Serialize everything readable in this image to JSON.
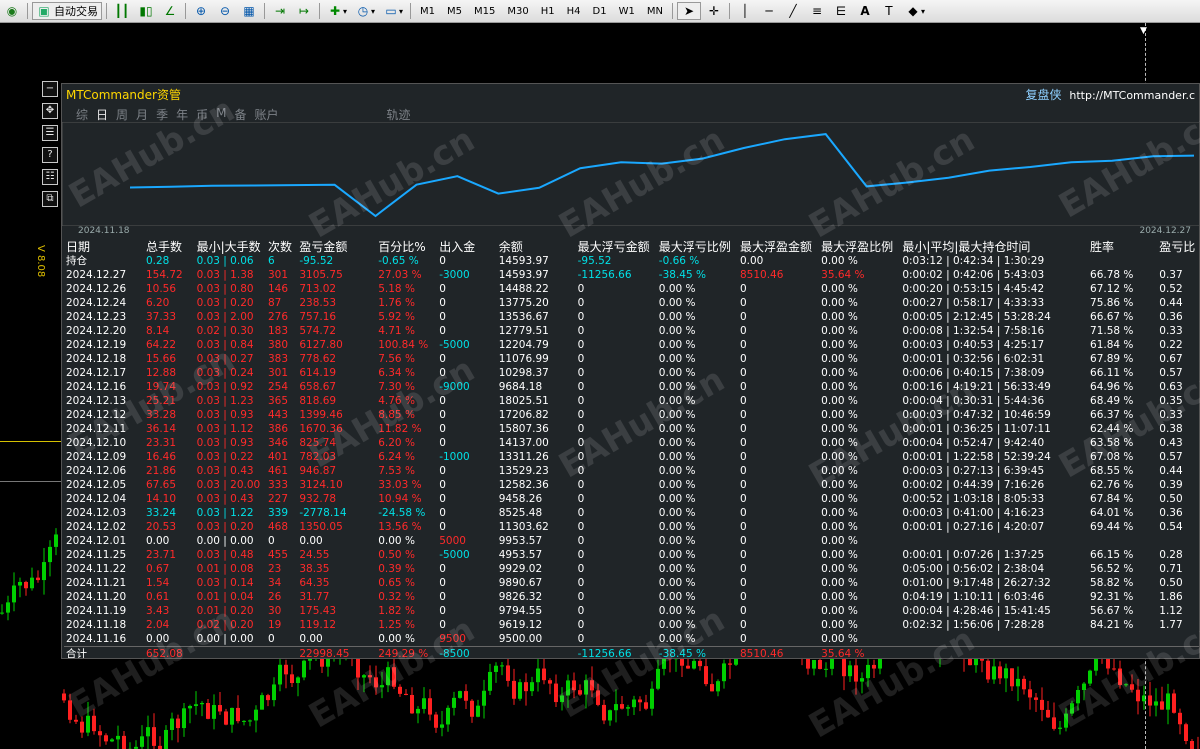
{
  "toolbar": {
    "autotrade_label": "自动交易",
    "timeframes": [
      "M1",
      "M5",
      "M15",
      "M30",
      "H1",
      "H4",
      "D1",
      "W1",
      "MN"
    ],
    "icons": [
      "globe-icon",
      "autotrade-icon",
      "bar-chart-icon",
      "candlestick-icon",
      "line-chart-icon",
      "zoom-in-icon",
      "zoom-out-icon",
      "tile-windows-icon",
      "chart-shift-icon",
      "autoscroll-icon",
      "new-order-icon",
      "clock-icon",
      "template-icon",
      "cursor-icon",
      "crosshair-icon",
      "vertical-line-icon",
      "horizontal-line-icon",
      "trendline-icon",
      "fibonacci-icon",
      "channel-icon",
      "text-icon",
      "text-label-icon",
      "shapes-icon"
    ]
  },
  "side_tools": [
    "−",
    "✥",
    "☰",
    "?",
    "☷",
    "⧉"
  ],
  "vertical_label": "V 8.08",
  "panel": {
    "title": "MTCommander资管",
    "brand": "复盘侠",
    "url": "http://MTCommander.c",
    "tabs": [
      "综",
      "日",
      "周",
      "月",
      "季",
      "年",
      "币",
      "M",
      "备",
      "账户",
      "轨迹"
    ],
    "active_tab": "日",
    "date_start": "2024.11.18",
    "date_end": "2024.12.27",
    "equity_curve": [
      9500,
      9619.12,
      9794.55,
      9826.32,
      9890.67,
      9929.02,
      4953.57,
      9953.57,
      11303.62,
      8525.48,
      9458.26,
      12582.36,
      13529.23,
      13311.26,
      14137,
      15807.36,
      17206.82,
      18025.51,
      9684.18,
      10298.37,
      11076.99,
      12204.79,
      12779.51,
      13536.67,
      13775.2,
      14488.22,
      14593.97
    ],
    "headers": [
      "日期",
      "总手数",
      "最小|大手数",
      "次数",
      "盈亏金额",
      "百分比%",
      "出入金",
      "余额",
      "最大浮亏金额",
      "最大浮亏比例",
      "最大浮盈金额",
      "最大浮盈比例",
      "最小|平均|最大持仓时间",
      "胜率",
      "盈亏比"
    ],
    "holding": {
      "label": "持仓",
      "lots": "0.28",
      "minmax": "0.03 | 0.06",
      "count": "6",
      "pnl": "-95.52",
      "pct": "-0.65 %",
      "io": "0",
      "balance": "14593.97",
      "maxloss": "-95.52",
      "maxlosspct": "-0.66 %",
      "maxprofit": "0.00",
      "maxprofitpct": "0.00 %",
      "time": "0:03:12 | 0:42:34 | 1:30:29",
      "win": "",
      "ratio": ""
    },
    "rows": [
      [
        "2024.12.27",
        "154.72",
        "0.03 | 1.38",
        "301",
        "3105.75",
        "27.03 %",
        "-3000",
        "14593.97",
        "-11256.66",
        "-38.45 %",
        "8510.46",
        "35.64 %",
        "0:00:02 | 0:42:06 | 5:43:03",
        "66.78 %",
        "0.37"
      ],
      [
        "2024.12.26",
        "10.56",
        "0.03 | 0.80",
        "146",
        "713.02",
        "5.18 %",
        "0",
        "14488.22",
        "0",
        "0.00 %",
        "0",
        "0.00 %",
        "0:00:20 | 0:53:15 | 4:45:42",
        "67.12 %",
        "0.52"
      ],
      [
        "2024.12.24",
        "6.20",
        "0.03 | 0.20",
        "87",
        "238.53",
        "1.76 %",
        "0",
        "13775.20",
        "0",
        "0.00 %",
        "0",
        "0.00 %",
        "0:00:27 | 0:58:17 | 4:33:33",
        "75.86 %",
        "0.44"
      ],
      [
        "2024.12.23",
        "37.33",
        "0.03 | 2.00",
        "276",
        "757.16",
        "5.92 %",
        "0",
        "13536.67",
        "0",
        "0.00 %",
        "0",
        "0.00 %",
        "0:00:05 | 2:12:45 | 53:28:24",
        "66.67 %",
        "0.36"
      ],
      [
        "2024.12.20",
        "8.14",
        "0.02 | 0.30",
        "183",
        "574.72",
        "4.71 %",
        "0",
        "12779.51",
        "0",
        "0.00 %",
        "0",
        "0.00 %",
        "0:00:08 | 1:32:54 | 7:58:16",
        "71.58 %",
        "0.33"
      ],
      [
        "2024.12.19",
        "64.22",
        "0.03 | 0.84",
        "380",
        "6127.80",
        "100.84 %",
        "-5000",
        "12204.79",
        "0",
        "0.00 %",
        "0",
        "0.00 %",
        "0:00:03 | 0:40:53 | 4:25:17",
        "61.84 %",
        "0.22"
      ],
      [
        "2024.12.18",
        "15.66",
        "0.03 | 0.27",
        "383",
        "778.62",
        "7.56 %",
        "0",
        "11076.99",
        "0",
        "0.00 %",
        "0",
        "0.00 %",
        "0:00:01 | 0:32:56 | 6:02:31",
        "67.89 %",
        "0.67"
      ],
      [
        "2024.12.17",
        "12.88",
        "0.03 | 0.24",
        "301",
        "614.19",
        "6.34 %",
        "0",
        "10298.37",
        "0",
        "0.00 %",
        "0",
        "0.00 %",
        "0:00:06 | 0:40:15 | 7:38:09",
        "66.11 %",
        "0.57"
      ],
      [
        "2024.12.16",
        "19.74",
        "0.03 | 0.92",
        "254",
        "658.67",
        "7.30 %",
        "-9000",
        "9684.18",
        "0",
        "0.00 %",
        "0",
        "0.00 %",
        "0:00:16 | 4:19:21 | 56:33:49",
        "64.96 %",
        "0.63"
      ],
      [
        "2024.12.13",
        "25.21",
        "0.03 | 1.23",
        "365",
        "818.69",
        "4.76 %",
        "0",
        "18025.51",
        "0",
        "0.00 %",
        "0",
        "0.00 %",
        "0:00:04 | 0:30:31 | 5:44:36",
        "68.49 %",
        "0.35"
      ],
      [
        "2024.12.12",
        "33.28",
        "0.03 | 0.93",
        "443",
        "1399.46",
        "8.85 %",
        "0",
        "17206.82",
        "0",
        "0.00 %",
        "0",
        "0.00 %",
        "0:00:03 | 0:47:32 | 10:46:59",
        "66.37 %",
        "0.33"
      ],
      [
        "2024.12.11",
        "36.14",
        "0.03 | 1.12",
        "386",
        "1670.36",
        "11.82 %",
        "0",
        "15807.36",
        "0",
        "0.00 %",
        "0",
        "0.00 %",
        "0:00:01 | 0:36:25 | 11:07:11",
        "62.44 %",
        "0.38"
      ],
      [
        "2024.12.10",
        "23.31",
        "0.03 | 0.93",
        "346",
        "825.74",
        "6.20 %",
        "0",
        "14137.00",
        "0",
        "0.00 %",
        "0",
        "0.00 %",
        "0:00:04 | 0:52:47 | 9:42:40",
        "63.58 %",
        "0.43"
      ],
      [
        "2024.12.09",
        "16.46",
        "0.03 | 0.22",
        "401",
        "782.03",
        "6.24 %",
        "-1000",
        "13311.26",
        "0",
        "0.00 %",
        "0",
        "0.00 %",
        "0:00:01 | 1:22:58 | 52:39:24",
        "67.08 %",
        "0.57"
      ],
      [
        "2024.12.06",
        "21.86",
        "0.03 | 0.43",
        "461",
        "946.87",
        "7.53 %",
        "0",
        "13529.23",
        "0",
        "0.00 %",
        "0",
        "0.00 %",
        "0:00:03 | 0:27:13 | 6:39:45",
        "68.55 %",
        "0.44"
      ],
      [
        "2024.12.05",
        "67.65",
        "0.03 | 20.00",
        "333",
        "3124.10",
        "33.03 %",
        "0",
        "12582.36",
        "0",
        "0.00 %",
        "0",
        "0.00 %",
        "0:00:02 | 0:44:39 | 7:16:26",
        "62.76 %",
        "0.39"
      ],
      [
        "2024.12.04",
        "14.10",
        "0.03 | 0.43",
        "227",
        "932.78",
        "10.94 %",
        "0",
        "9458.26",
        "0",
        "0.00 %",
        "0",
        "0.00 %",
        "0:00:52 | 1:03:18 | 8:05:33",
        "67.84 %",
        "0.50"
      ],
      [
        "2024.12.03",
        "33.24",
        "0.03 | 1.22",
        "339",
        "-2778.14",
        "-24.58 %",
        "0",
        "8525.48",
        "0",
        "0.00 %",
        "0",
        "0.00 %",
        "0:00:03 | 0:41:00 | 4:16:23",
        "64.01 %",
        "0.36"
      ],
      [
        "2024.12.02",
        "20.53",
        "0.03 | 0.20",
        "468",
        "1350.05",
        "13.56 %",
        "0",
        "11303.62",
        "0",
        "0.00 %",
        "0",
        "0.00 %",
        "0:00:01 | 0:27:16 | 4:20:07",
        "69.44 %",
        "0.54"
      ],
      [
        "2024.12.01",
        "0.00",
        "0.00 | 0.00",
        "0",
        "0.00",
        "0.00 %",
        "5000",
        "9953.57",
        "0",
        "0.00 %",
        "0",
        "0.00 %",
        "",
        "",
        ""
      ],
      [
        "2024.11.25",
        "23.71",
        "0.03 | 0.48",
        "455",
        "24.55",
        "0.50 %",
        "-5000",
        "4953.57",
        "0",
        "0.00 %",
        "0",
        "0.00 %",
        "0:00:01 | 0:07:26 | 1:37:25",
        "66.15 %",
        "0.28"
      ],
      [
        "2024.11.22",
        "0.67",
        "0.01 | 0.08",
        "23",
        "38.35",
        "0.39 %",
        "0",
        "9929.02",
        "0",
        "0.00 %",
        "0",
        "0.00 %",
        "0:05:00 | 0:56:02 | 2:38:04",
        "56.52 %",
        "0.71"
      ],
      [
        "2024.11.21",
        "1.54",
        "0.03 | 0.14",
        "34",
        "64.35",
        "0.65 %",
        "0",
        "9890.67",
        "0",
        "0.00 %",
        "0",
        "0.00 %",
        "0:01:00 | 9:17:48 | 26:27:32",
        "58.82 %",
        "0.50"
      ],
      [
        "2024.11.20",
        "0.61",
        "0.01 | 0.04",
        "26",
        "31.77",
        "0.32 %",
        "0",
        "9826.32",
        "0",
        "0.00 %",
        "0",
        "0.00 %",
        "0:04:19 | 1:10:11 | 6:03:46",
        "92.31 %",
        "1.86"
      ],
      [
        "2024.11.19",
        "3.43",
        "0.01 | 0.20",
        "30",
        "175.43",
        "1.82 %",
        "0",
        "9794.55",
        "0",
        "0.00 %",
        "0",
        "0.00 %",
        "0:00:04 | 4:28:46 | 15:41:45",
        "56.67 %",
        "1.12"
      ],
      [
        "2024.11.18",
        "2.04",
        "0.02 | 0.20",
        "19",
        "119.12",
        "1.25 %",
        "0",
        "9619.12",
        "0",
        "0.00 %",
        "0",
        "0.00 %",
        "0:02:32 | 1:56:06 | 7:28:28",
        "84.21 %",
        "1.77"
      ],
      [
        "2024.11.16",
        "0.00",
        "0.00 | 0.00",
        "0",
        "0.00",
        "0.00 %",
        "9500",
        "9500.00",
        "0",
        "0.00 %",
        "0",
        "0.00 %",
        "",
        "",
        ""
      ]
    ],
    "total": {
      "label": "合计",
      "lots": "652.08",
      "pnl": "22998.45",
      "pct": "249.29 %",
      "io": "-8500",
      "maxloss": "-11256.66",
      "maxlosspct": "-38.45 %",
      "maxprofit": "8510.46",
      "maxprofitpct": "35.64 %"
    }
  },
  "watermark": "EAHub.cn"
}
